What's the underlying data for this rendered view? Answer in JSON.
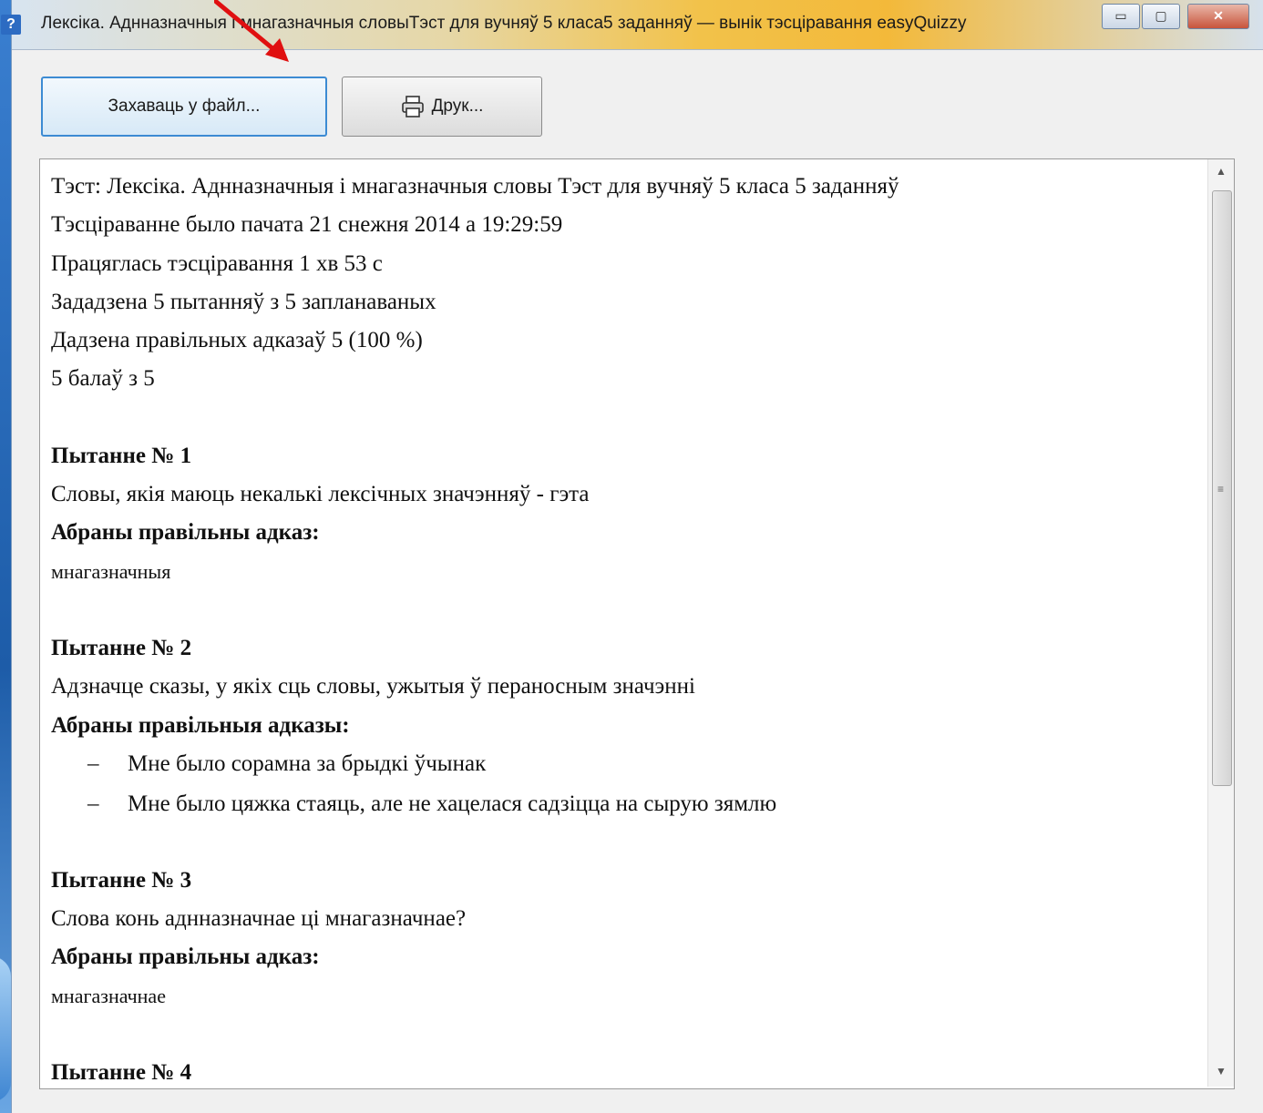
{
  "window": {
    "title": "Лексіка. Аднназначныя і мнагазначныя словыТэст для вучняў 5 класа5 заданняў — вынік тэсціравання easyQuizzy",
    "help_icon": "?"
  },
  "controls": {
    "minimize": "▭",
    "maximize": "▢",
    "close": "✕"
  },
  "toolbar": {
    "save_label": "Захаваць у файл...",
    "print_label": "Друк..."
  },
  "report": {
    "test": "Тэст: Лексіка. Аднназначныя і мнагазначныя словы Тэст для вучняў 5 класа 5 заданняў",
    "started": "Тэсціраванне было пачата 21 снежня 2014 а 19:29:59",
    "duration": "Працяглась тэсціравання 1 хв 53 с",
    "asked": "Зададзена 5 пытанняў з 5 запланаваных",
    "correct": "Дадзена правільных адказаў 5 (100 %)",
    "score": "5 балаў з 5",
    "questions": [
      {
        "heading": "Пытанне № 1",
        "text": "Словы, якія маюць некалькі лексічных значэнняў - гэта",
        "answer_label": "Абраны правільны адказ:",
        "answer": "мнагазначныя"
      },
      {
        "heading": "Пытанне № 2",
        "text": "Адзначце сказы, у якіх сць словы,  ужытыя ў пераносным значэнні",
        "answer_label": "Абраны правільныя адказы:",
        "answers": [
          "Мне было сорамна за брыдкі ўчынак",
          "Мне было цяжка стаяць, але не хацелася садзіцца на сырую зямлю"
        ],
        "dash": "–"
      },
      {
        "heading": "Пытанне № 3",
        "text": "Слова конь аднназначнае ці мнагазначнае?",
        "answer_label": "Абраны правільны адказ:",
        "answer": "мнагазначнае"
      },
      {
        "heading": "Пытанне № 4"
      }
    ]
  },
  "icons": {
    "printer": "printer-icon",
    "annotation": "red-arrow"
  },
  "colors": {
    "accent": "#3c8bd3",
    "arrow": "#e01010"
  }
}
